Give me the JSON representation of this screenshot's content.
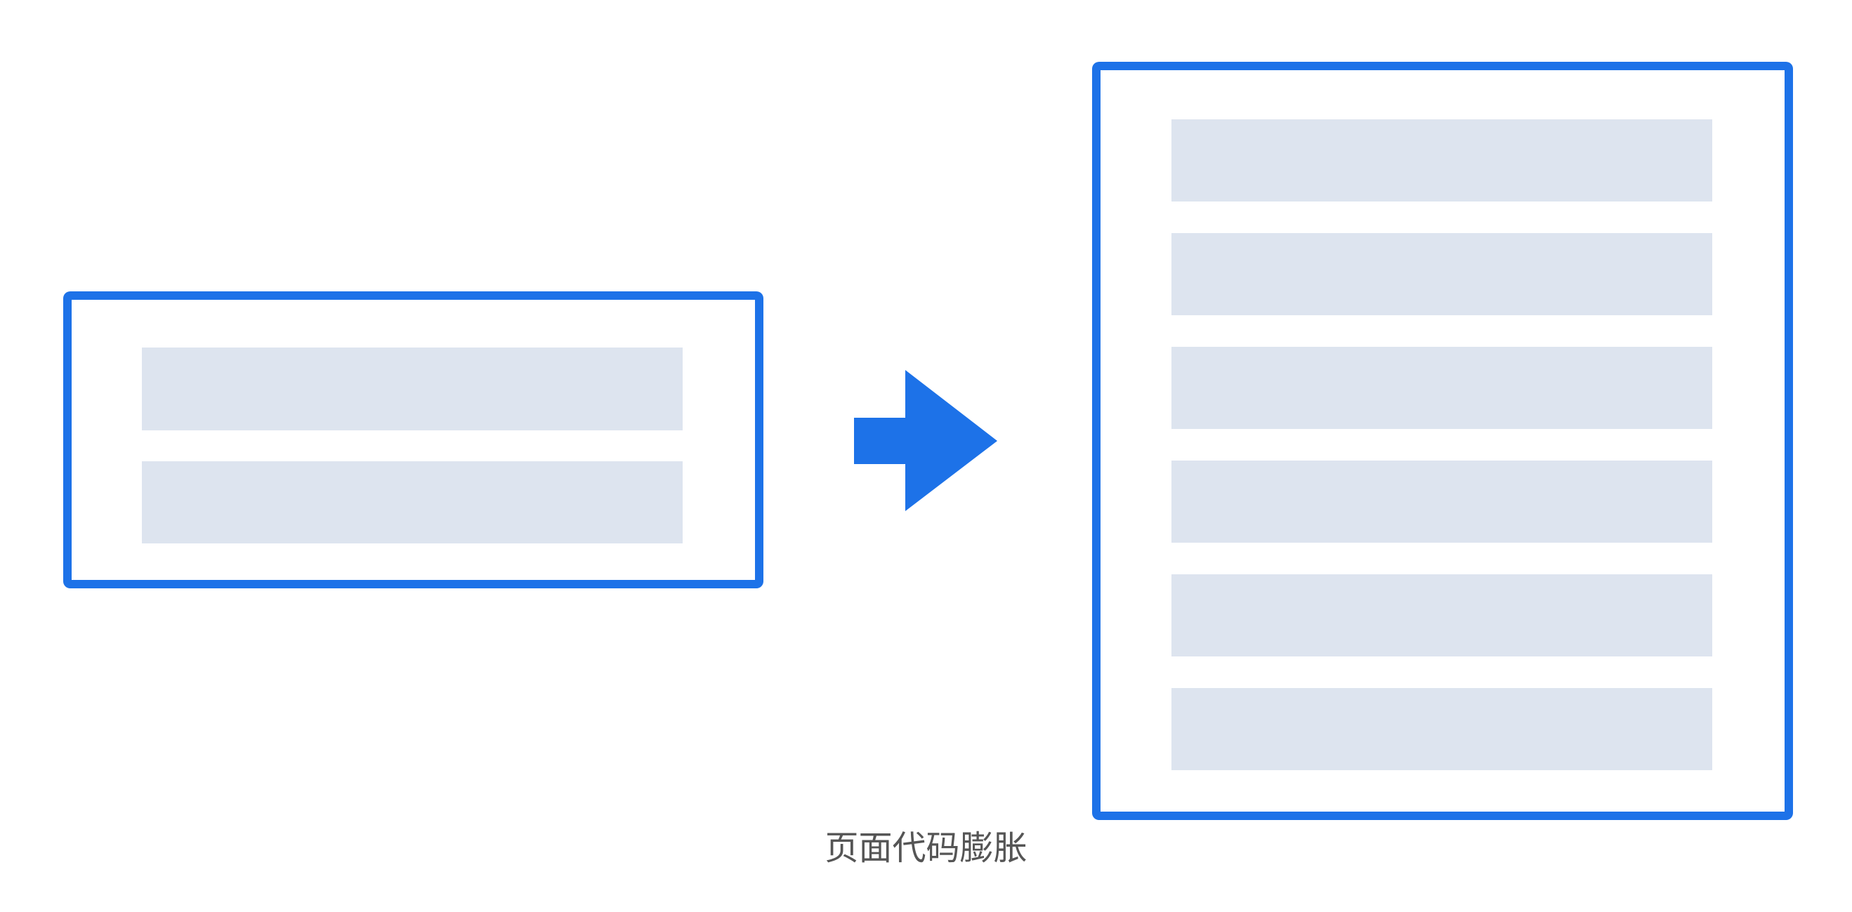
{
  "diagram": {
    "accent_color": "#1d72e8",
    "block_color": "#dde4ef",
    "caption_color": "#555555",
    "before": {
      "label": "",
      "block_count": 2
    },
    "after": {
      "label": "",
      "block_count": 6
    },
    "arrow": {
      "direction": "right",
      "icon": "arrow-right-icon"
    },
    "caption": "页面代码膨胀"
  }
}
